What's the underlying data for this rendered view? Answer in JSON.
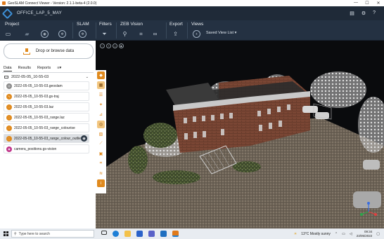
{
  "window": {
    "title": "GeoSLAM Connect Viewer - Version: 2.1.1-beta-4 (2.0.0)",
    "controls": [
      "—",
      "☐",
      "✕"
    ]
  },
  "header": {
    "project_name": "OFFICE_LAP_5_MAY",
    "icons": [
      "document-icon",
      "settings-gear-icon",
      "help-icon"
    ]
  },
  "ribbon": {
    "groups": {
      "project": "Project",
      "slam": "SLAM",
      "filters": "Filters",
      "zeb_vision": "ZEB Vision",
      "export": "Export",
      "views": "Views"
    },
    "saved_view_list": "Saved View List"
  },
  "left_panel": {
    "drop_label": "Drop or browse data",
    "tabs": [
      "Data",
      "Results",
      "Reports",
      "≡▾"
    ],
    "active_tab": "Data",
    "folder": "2022-05-05_10-55-03",
    "files": [
      {
        "name": "2022-05-05_10-55-03.geoslam",
        "color": "#8b8b8b"
      },
      {
        "name": "2022-05-05_10-55-03.gs-traj",
        "color": "#e08a1e"
      },
      {
        "name": "2022-05-05_10-55-03.laz",
        "color": "#e08a1e"
      },
      {
        "name": "2022-05-05_10-55-03_range.laz",
        "color": "#e08a1e"
      },
      {
        "name": "2022-05-05_10-55-03_range_colourise",
        "color": "#e08a1e"
      },
      {
        "name": "2022-05-05_10-55-03_range_colour_outlier",
        "color": "#e08a1e",
        "selected": true
      },
      {
        "name": "camera_positions.gs-vision",
        "color": "#c0348a"
      }
    ]
  },
  "viewport": {
    "top_buttons": [
      "−",
      "+",
      "○",
      "■"
    ],
    "axes": {
      "x": "X",
      "y": "Y",
      "z": "Z"
    }
  },
  "taskbar": {
    "search_placeholder": "Type here to search",
    "weather": "13°C  Mostly sunny",
    "time": "09:34",
    "date": "23/05/2022"
  },
  "colors": {
    "accent_orange": "#e08a1e",
    "header_bg": "#1f2a38",
    "ribbon_bg": "#243142"
  }
}
